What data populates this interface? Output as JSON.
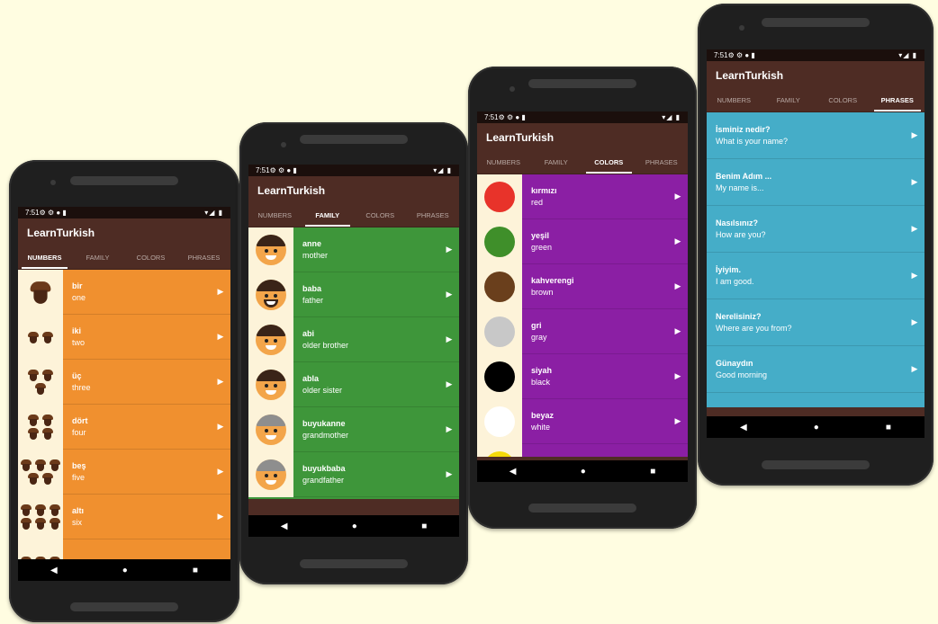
{
  "app_title": "LearnTurkish",
  "status_time": "7:51",
  "status_icons": "⚙ ⚙ ● ▮",
  "status_right": "▾◢ ▮",
  "tabs": [
    "NUMBERS",
    "FAMILY",
    "COLORS",
    "PHRASES"
  ],
  "nav": {
    "back": "◀",
    "home": "●",
    "recents": "■"
  },
  "numbers": {
    "active_tab": 0,
    "bg_color": "#f0902f",
    "items": [
      {
        "turkish": "bir",
        "english": "one",
        "count": 1
      },
      {
        "turkish": "iki",
        "english": "two",
        "count": 2
      },
      {
        "turkish": "üç",
        "english": "three",
        "count": 3
      },
      {
        "turkish": "dört",
        "english": "four",
        "count": 4
      },
      {
        "turkish": "beş",
        "english": "five",
        "count": 5
      },
      {
        "turkish": "altı",
        "english": "six",
        "count": 6
      }
    ]
  },
  "family": {
    "active_tab": 1,
    "bg_color": "#3e963a",
    "items": [
      {
        "turkish": "anne",
        "english": "mother",
        "icon": "mother-face-icon"
      },
      {
        "turkish": "baba",
        "english": "father",
        "icon": "father-face-icon"
      },
      {
        "turkish": "abi",
        "english": "older brother",
        "icon": "older-brother-face-icon"
      },
      {
        "turkish": "abla",
        "english": "older sister",
        "icon": "older-sister-face-icon"
      },
      {
        "turkish": "buyukanne",
        "english": "grandmother",
        "icon": "grandmother-face-icon"
      },
      {
        "turkish": "buyukbaba",
        "english": "grandfather",
        "icon": "grandfather-face-icon"
      }
    ]
  },
  "colors": {
    "active_tab": 2,
    "bg_color": "#8b1fa4",
    "items": [
      {
        "turkish": "kırmızı",
        "english": "red",
        "swatch": "#e8332a"
      },
      {
        "turkish": "yeşil",
        "english": "green",
        "swatch": "#3f8f2a"
      },
      {
        "turkish": "kahverengi",
        "english": "brown",
        "swatch": "#6a3f1c"
      },
      {
        "turkish": "gri",
        "english": "gray",
        "swatch": "#c8c8c8"
      },
      {
        "turkish": "siyah",
        "english": "black",
        "swatch": "#000000"
      },
      {
        "turkish": "beyaz",
        "english": "white",
        "swatch": "#ffffff"
      }
    ]
  },
  "phrases": {
    "active_tab": 3,
    "bg_color": "#45adc8",
    "items": [
      {
        "turkish": "İsminiz nedir?",
        "english": "What is your name?"
      },
      {
        "turkish": "Benim Adım ...",
        "english": "My name is..."
      },
      {
        "turkish": "Nasılsınız?",
        "english": "How are you?"
      },
      {
        "turkish": "İyiyim.",
        "english": "I am good."
      },
      {
        "turkish": "Nerelisiniz?",
        "english": "Where are you from?"
      },
      {
        "turkish": "Günaydın",
        "english": "Good morning"
      }
    ]
  }
}
